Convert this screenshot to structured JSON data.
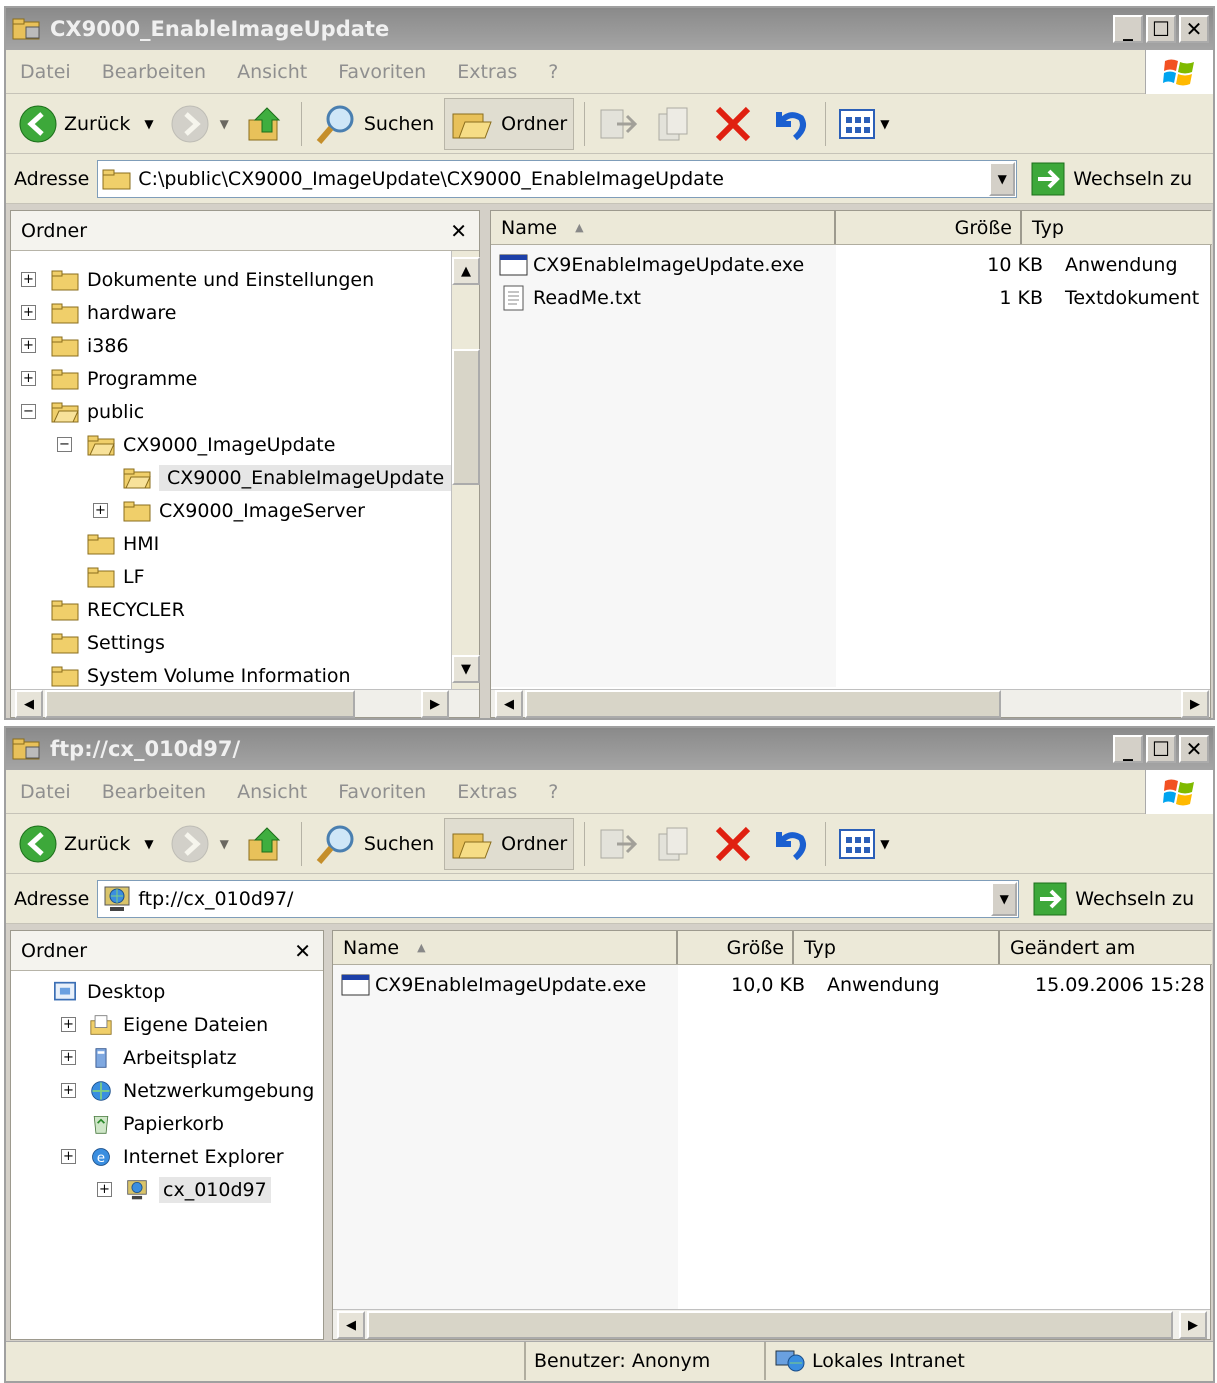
{
  "window1": {
    "title": "CX9000_EnableImageUpdate",
    "menu": [
      "Datei",
      "Bearbeiten",
      "Ansicht",
      "Favoriten",
      "Extras",
      "?"
    ],
    "toolbar": {
      "back": "Zurück",
      "search": "Suchen",
      "folders": "Ordner"
    },
    "address_label": "Adresse",
    "address": "C:\\public\\CX9000_ImageUpdate\\CX9000_EnableImageUpdate",
    "go": "Wechseln zu",
    "folder_pane_title": "Ordner",
    "tree": [
      {
        "label": "Dokumente und Einstellungen",
        "expander": "+"
      },
      {
        "label": "hardware",
        "expander": "+"
      },
      {
        "label": "i386",
        "expander": "+"
      },
      {
        "label": "Programme",
        "expander": "+"
      },
      {
        "label": "public",
        "expander": "−"
      },
      {
        "label": "CX9000_ImageUpdate",
        "expander": "−"
      },
      {
        "label": "CX9000_EnableImageUpdate",
        "expander": ""
      },
      {
        "label": "CX9000_ImageServer",
        "expander": "+"
      },
      {
        "label": "HMI",
        "expander": ""
      },
      {
        "label": "LF",
        "expander": ""
      },
      {
        "label": "RECYCLER",
        "expander": ""
      },
      {
        "label": "Settings",
        "expander": ""
      },
      {
        "label": "System Volume Information",
        "expander": ""
      }
    ],
    "columns": [
      "Name",
      "Größe",
      "Typ"
    ],
    "files": [
      {
        "name": "CX9EnableImageUpdate.exe",
        "size": "10 KB",
        "type": "Anwendung",
        "icon": "exe-icon"
      },
      {
        "name": "ReadMe.txt",
        "size": "1 KB",
        "type": "Textdokument",
        "icon": "txt-icon"
      }
    ]
  },
  "window2": {
    "title": "ftp://cx_010d97/",
    "menu": [
      "Datei",
      "Bearbeiten",
      "Ansicht",
      "Favoriten",
      "Extras",
      "?"
    ],
    "toolbar": {
      "back": "Zurück",
      "search": "Suchen",
      "folders": "Ordner"
    },
    "address_label": "Adresse",
    "address": "ftp://cx_010d97/",
    "go": "Wechseln zu",
    "folder_pane_title": "Ordner",
    "tree": [
      {
        "label": "Desktop",
        "expander": ""
      },
      {
        "label": "Eigene Dateien",
        "expander": "+"
      },
      {
        "label": "Arbeitsplatz",
        "expander": "+"
      },
      {
        "label": "Netzwerkumgebung",
        "expander": "+"
      },
      {
        "label": "Papierkorb",
        "expander": ""
      },
      {
        "label": "Internet Explorer",
        "expander": "+"
      },
      {
        "label": "cx_010d97",
        "expander": "+"
      }
    ],
    "columns": [
      "Name",
      "Größe",
      "Typ",
      "Geändert am"
    ],
    "files": [
      {
        "name": "CX9EnableImageUpdate.exe",
        "size": "10,0 KB",
        "type": "Anwendung",
        "modified": "15.09.2006 15:28"
      }
    ],
    "status": {
      "user": "Benutzer: Anonym",
      "zone": "Lokales Intranet"
    }
  }
}
